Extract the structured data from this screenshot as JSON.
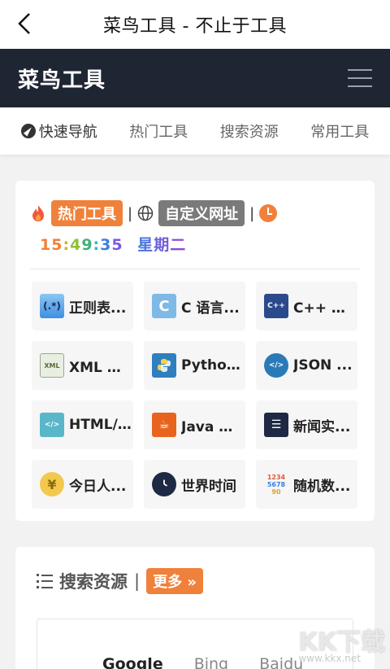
{
  "titlebar": {
    "title": "菜鸟工具 - 不止于工具"
  },
  "header": {
    "brand": "菜鸟工具"
  },
  "nav": {
    "items": [
      "快速导航",
      "热门工具",
      "搜索资源",
      "常用工具"
    ]
  },
  "hot": {
    "tag_hot": "热门工具",
    "sep1": "|",
    "tag_custom": "自定义网址",
    "sep2": "|",
    "time": "15:49:35",
    "weekday": "星期二",
    "time_colors": [
      "#f0813a",
      "#f0813a",
      "#d4b11c",
      "#8cc03a",
      "#3fb07a",
      "#32b6c4",
      "#3b7de0",
      "#7a5ae0"
    ]
  },
  "tools": [
    {
      "label": "正则表...",
      "icon": "regex-icon"
    },
    {
      "label": "C 语言...",
      "icon": "c-icon"
    },
    {
      "label": "C++ 在...",
      "icon": "cpp-icon"
    },
    {
      "label": "XML 格...",
      "icon": "xml-icon"
    },
    {
      "label": "Python...",
      "icon": "python-icon"
    },
    {
      "label": "JSON ...",
      "icon": "json-icon"
    },
    {
      "label": "HTML/...",
      "icon": "html-icon"
    },
    {
      "label": "Java 在...",
      "icon": "java-icon"
    },
    {
      "label": "新闻实...",
      "icon": "news-icon"
    },
    {
      "label": "今日人...",
      "icon": "yen-icon"
    },
    {
      "label": "世界时间",
      "icon": "clock-icon"
    },
    {
      "label": "随机数...",
      "icon": "random-numbers-icon"
    }
  ],
  "search": {
    "title": "搜索资源",
    "sep": "|",
    "more": "更多 »",
    "engines": [
      "Google",
      "Bing",
      "Baidu"
    ]
  },
  "watermark": {
    "text": "KK下载",
    "url": "www.kkx.net"
  }
}
